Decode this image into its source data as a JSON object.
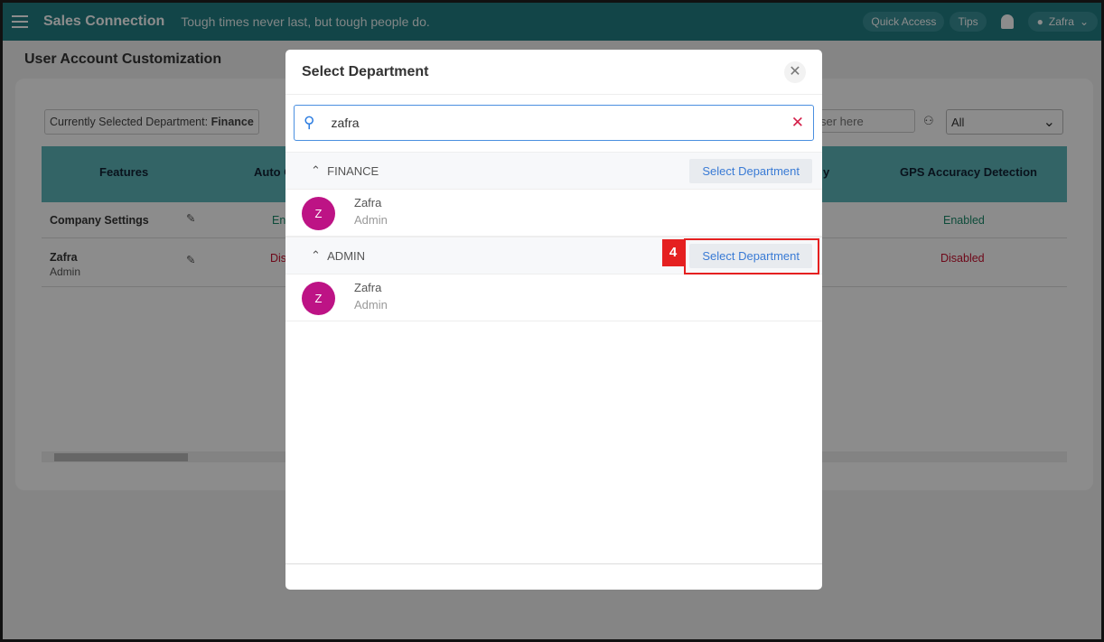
{
  "header": {
    "brand": "Sales Connection",
    "tagline": "Tough times never last, but tough people do.",
    "quick_access": "Quick Access",
    "tips": "Tips",
    "user": "Zafra"
  },
  "page": {
    "title": "User Account Customization",
    "current_dept_label": "Currently Selected Department:",
    "current_dept_value": "Finance",
    "search_partial": "ser here",
    "filter_value": "All"
  },
  "table": {
    "headers": [
      "Features",
      "Auto C",
      "y",
      "GPS Accuracy Detection"
    ],
    "rows": [
      {
        "name": "Company Settings",
        "role": "",
        "c1": "En",
        "gps": "Enabled"
      },
      {
        "name": "Zafra",
        "role": "Admin",
        "c1": "Dis",
        "gps": "Disabled"
      }
    ]
  },
  "modal": {
    "title": "Select Department",
    "search_value": "zafra",
    "groups": [
      {
        "name": "FINANCE",
        "button": "Select Department",
        "users": [
          {
            "initial": "Z",
            "name": "Zafra",
            "role": "Admin"
          }
        ]
      },
      {
        "name": "ADMIN",
        "button": "Select Department",
        "users": [
          {
            "initial": "Z",
            "name": "Zafra",
            "role": "Admin"
          }
        ]
      }
    ]
  },
  "annotation": {
    "step": "4"
  },
  "colors": {
    "header": "#227e84",
    "avatar": "#bd1385",
    "enabled": "#1a8a6a",
    "disabled": "#c8102e",
    "highlight": "#e52020"
  }
}
